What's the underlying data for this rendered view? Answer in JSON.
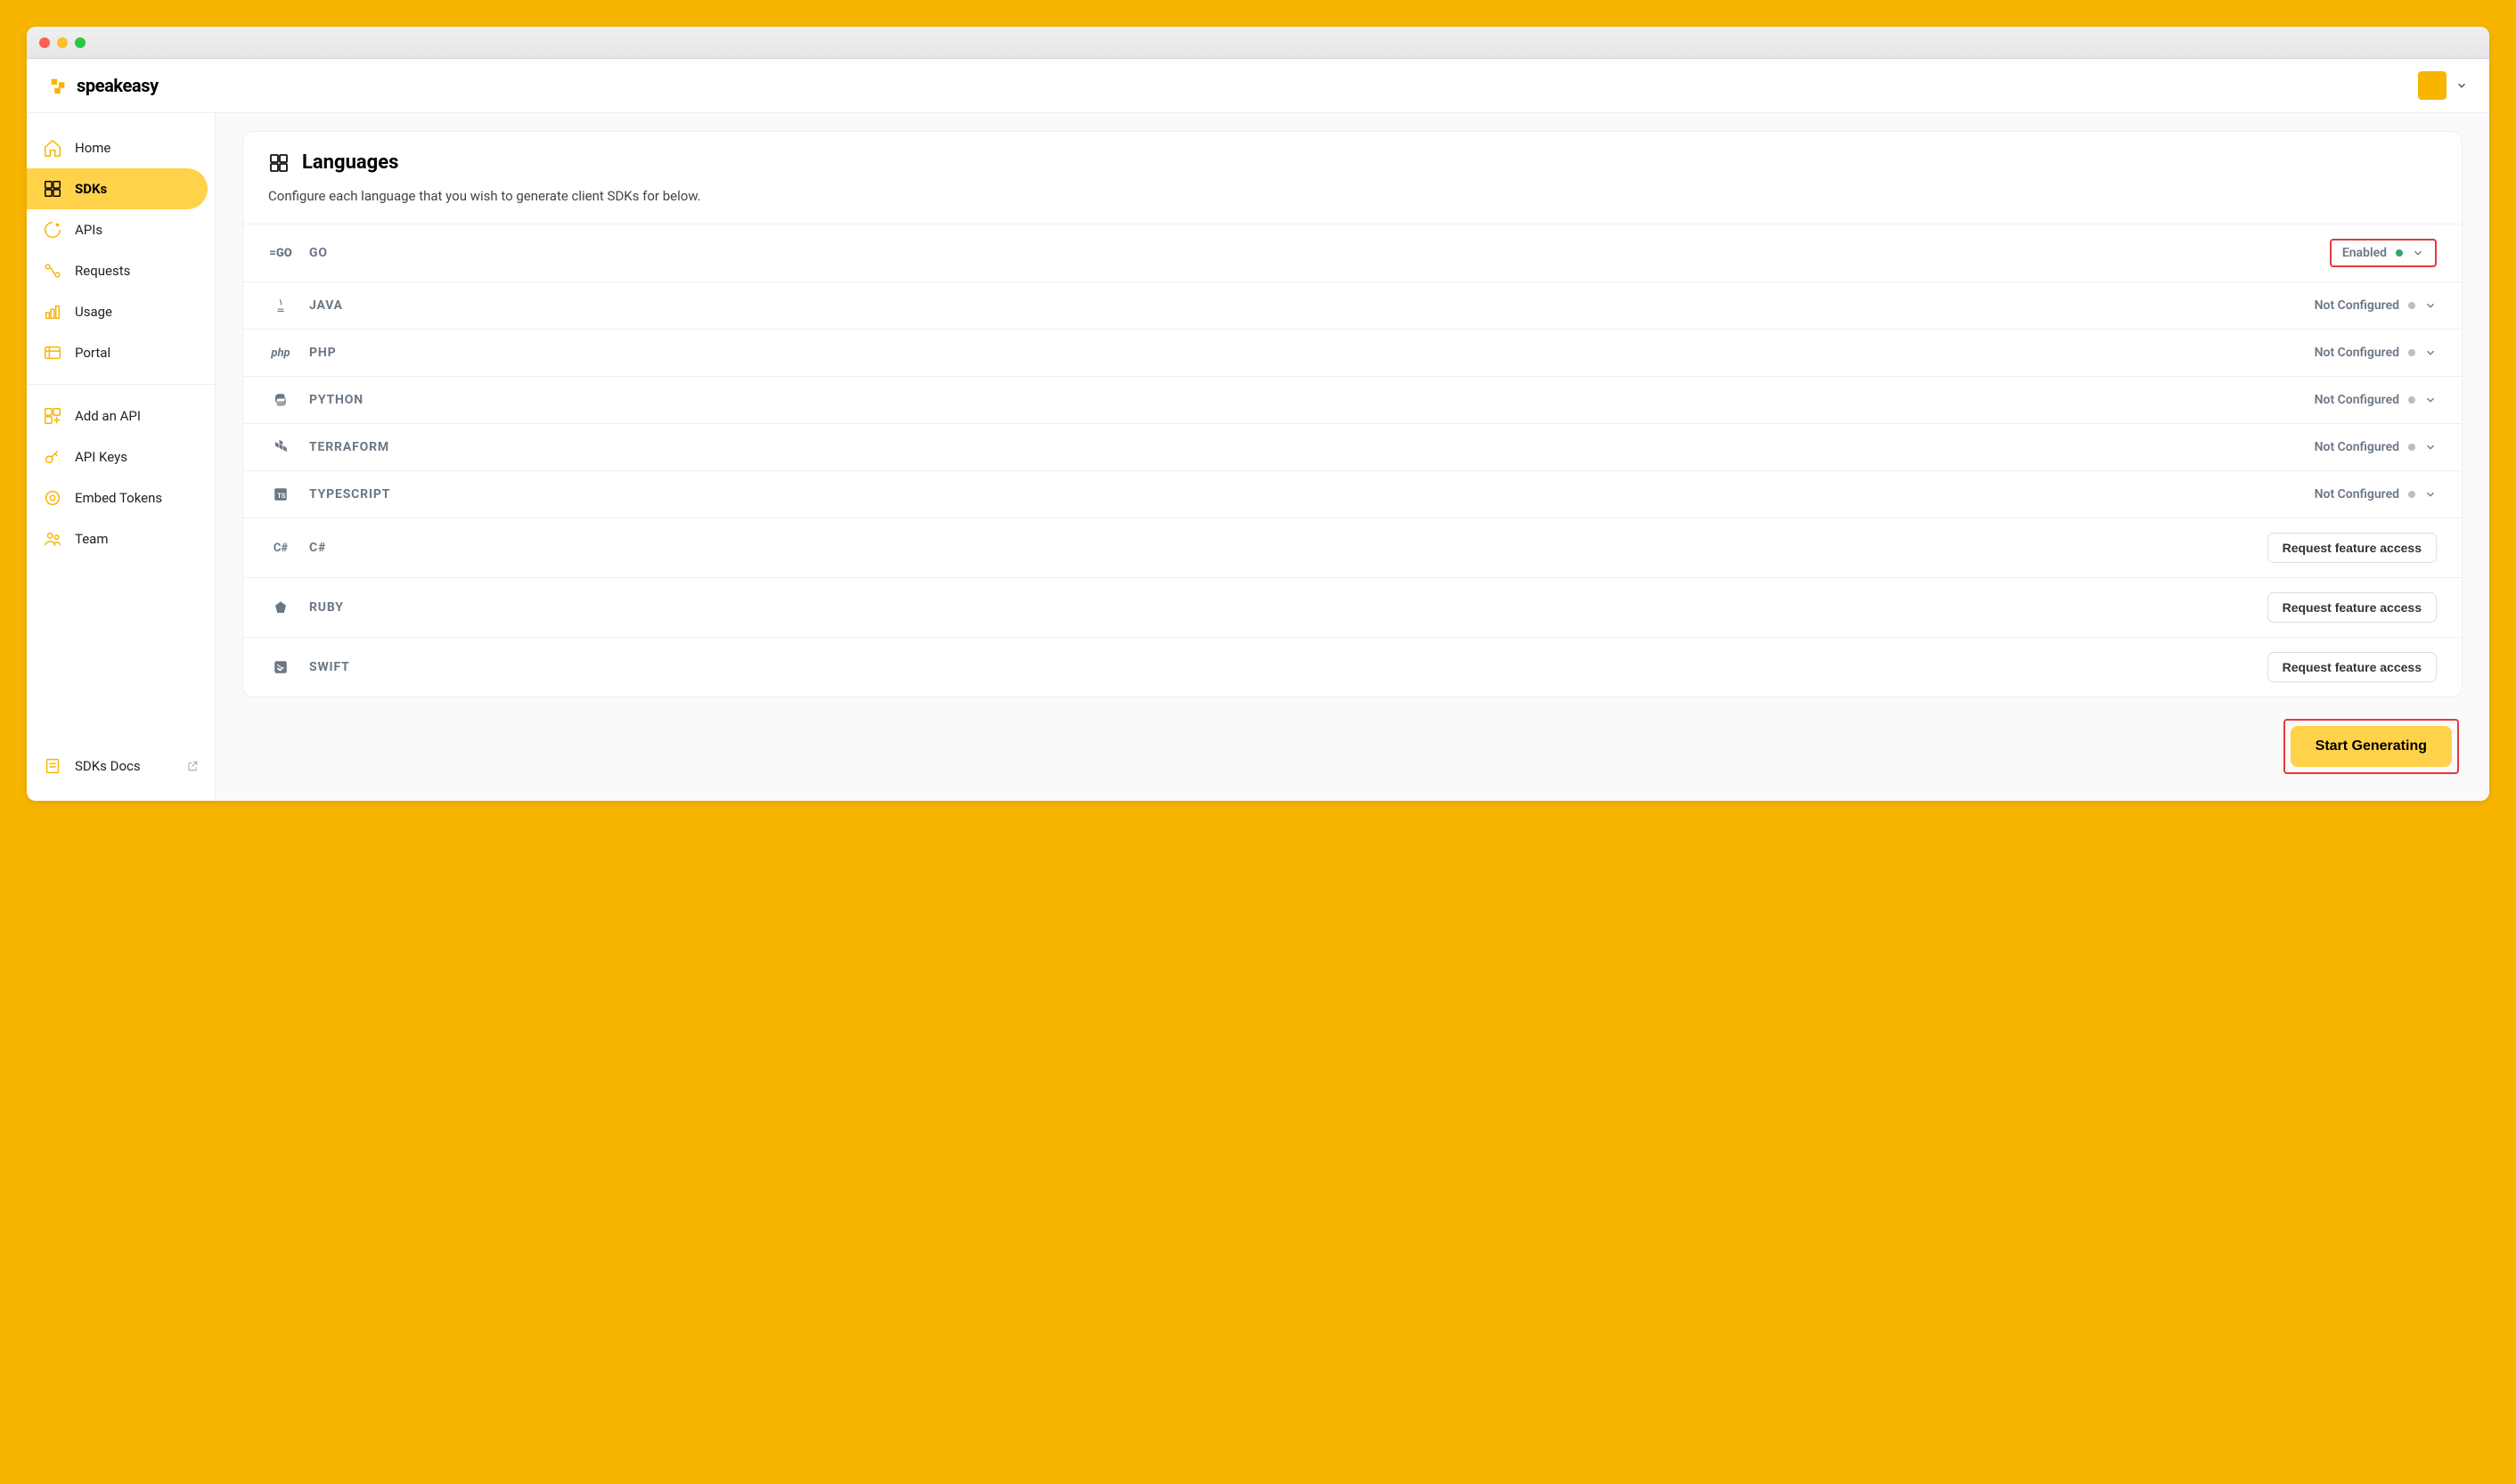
{
  "brand": "speakeasy",
  "sidebar": {
    "primary": [
      {
        "label": "Home",
        "icon": "home",
        "active": false
      },
      {
        "label": "SDKs",
        "icon": "grid",
        "active": true
      },
      {
        "label": "APIs",
        "icon": "cycle",
        "active": false
      },
      {
        "label": "Requests",
        "icon": "requests",
        "active": false
      },
      {
        "label": "Usage",
        "icon": "chart",
        "active": false
      },
      {
        "label": "Portal",
        "icon": "portal",
        "active": false
      }
    ],
    "secondary": [
      {
        "label": "Add an API",
        "icon": "add-api"
      },
      {
        "label": "API Keys",
        "icon": "key"
      },
      {
        "label": "Embed Tokens",
        "icon": "token"
      },
      {
        "label": "Team",
        "icon": "team"
      }
    ],
    "footer": [
      {
        "label": "SDKs Docs",
        "icon": "docs",
        "external": true
      }
    ]
  },
  "panel": {
    "title": "Languages",
    "subtitle": "Configure each language that you wish to generate client SDKs for below."
  },
  "languages": [
    {
      "name": "GO",
      "status": "Enabled",
      "dot": "green",
      "expandable": true,
      "highlight": true
    },
    {
      "name": "JAVA",
      "status": "Not Configured",
      "dot": "grey",
      "expandable": true
    },
    {
      "name": "PHP",
      "status": "Not Configured",
      "dot": "grey",
      "expandable": true
    },
    {
      "name": "PYTHON",
      "status": "Not Configured",
      "dot": "grey",
      "expandable": true
    },
    {
      "name": "TERRAFORM",
      "status": "Not Configured",
      "dot": "grey",
      "expandable": true
    },
    {
      "name": "TYPESCRIPT",
      "status": "Not Configured",
      "dot": "grey",
      "expandable": true
    },
    {
      "name": "C#",
      "request": true
    },
    {
      "name": "RUBY",
      "request": true
    },
    {
      "name": "SWIFT",
      "request": true
    }
  ],
  "labels": {
    "request_access": "Request feature access",
    "start_generating": "Start Generating"
  }
}
